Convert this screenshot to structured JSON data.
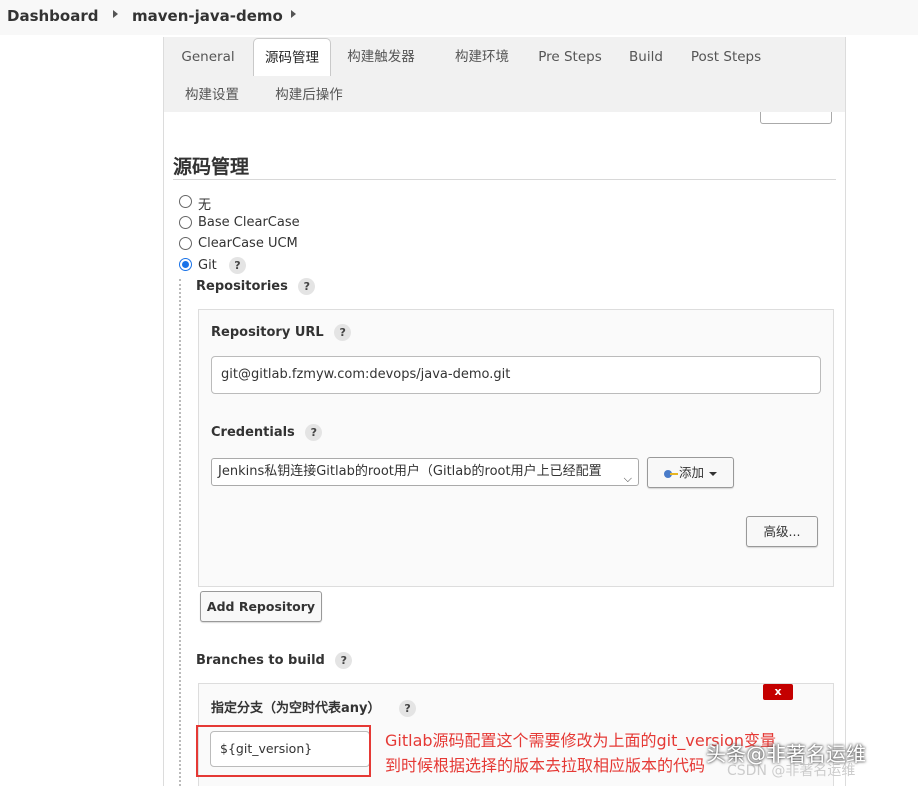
{
  "breadcrumb": {
    "items": [
      "Dashboard",
      "maven-java-demo"
    ]
  },
  "tabs": [
    {
      "label": "General"
    },
    {
      "label": "源码管理"
    },
    {
      "label": "构建触发器"
    },
    {
      "label": "构建环境"
    },
    {
      "label": "Pre Steps"
    },
    {
      "label": "Build"
    },
    {
      "label": "Post Steps"
    },
    {
      "label": "构建设置"
    },
    {
      "label": "构建后操作"
    }
  ],
  "active_tab": "源码管理",
  "section": {
    "title": "源码管理"
  },
  "scm_options": [
    {
      "label": "无",
      "checked": false
    },
    {
      "label": "Base ClearCase",
      "checked": false
    },
    {
      "label": "ClearCase UCM",
      "checked": false
    },
    {
      "label": "Git",
      "checked": true
    }
  ],
  "help_glyph": "?",
  "repositories": {
    "label": "Repositories",
    "url_label": "Repository URL",
    "url_value": "git@gitlab.fzmyw.com:devops/java-demo.git",
    "credentials_label": "Credentials",
    "credentials_selected": "Jenkins私钥连接Gitlab的root用户（Gitlab的root用户上已经配置",
    "add_button_label": "添加",
    "advanced_button_label": "高级...",
    "add_repository_label": "Add Repository"
  },
  "branches": {
    "label": "Branches to build",
    "specifier_label": "指定分支（为空时代表any）",
    "specifier_value": "${git_version}",
    "delete_label": "x"
  },
  "annotation": {
    "line1": "Gitlab源码配置这个需要修改为上面的git_version变量",
    "line2": "到时候根据选择的版本去拉取相应版本的代码"
  },
  "watermark": {
    "text": "头条@非著名运维",
    "small_text": "CSDN @非著名运维"
  },
  "colors": {
    "accent": "#1a73e8",
    "annotation_red": "#e53935",
    "delete_red": "#c40000"
  }
}
